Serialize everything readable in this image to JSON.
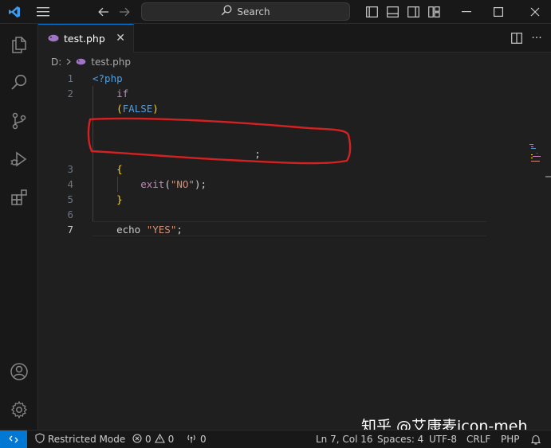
{
  "titlebar": {
    "search_placeholder": "Search"
  },
  "tab": {
    "filename": "test.php"
  },
  "breadcrumb": {
    "drive": "D:",
    "file": "test.php"
  },
  "editor": {
    "lines": [
      {
        "num": "1",
        "parts": [
          [
            "c-tag",
            "<?php"
          ]
        ]
      },
      {
        "num": "2",
        "parts": [
          [
            "c-plain",
            "    "
          ],
          [
            "c-kw",
            "if"
          ]
        ]
      },
      {
        "num": "",
        "parts": [
          [
            "c-plain",
            "    "
          ],
          [
            "c-paren",
            "("
          ],
          [
            "c-const",
            "FALSE"
          ],
          [
            "c-paren",
            ")"
          ]
        ]
      },
      {
        "num": "",
        "parts": []
      },
      {
        "num": "",
        "parts": []
      },
      {
        "num": "",
        "parts": [
          [
            "c-plain",
            "                           ;"
          ]
        ]
      },
      {
        "num": "3",
        "parts": [
          [
            "c-plain",
            "    "
          ],
          [
            "c-paren",
            "{"
          ]
        ]
      },
      {
        "num": "4",
        "parts": [
          [
            "c-plain",
            "        "
          ],
          [
            "c-fn",
            "exit"
          ],
          [
            "c-plain",
            "("
          ],
          [
            "c-str",
            "\"NO\""
          ],
          [
            "c-plain",
            ");"
          ]
        ]
      },
      {
        "num": "5",
        "parts": [
          [
            "c-plain",
            "    "
          ],
          [
            "c-paren",
            "}"
          ]
        ]
      },
      {
        "num": "6",
        "parts": []
      },
      {
        "num": "7",
        "parts": [
          [
            "c-plain",
            "    echo "
          ],
          [
            "c-str",
            "\"YES\""
          ],
          [
            "c-plain",
            ";"
          ]
        ]
      }
    ],
    "active_line": "7"
  },
  "watermark": "知乎 @艾康麦icon-meh",
  "statusbar": {
    "restricted_mode": "Restricted Mode",
    "errors": "0",
    "warnings": "0",
    "ports": "0",
    "position": "Ln 7, Col 16",
    "spaces": "Spaces: 4",
    "encoding": "UTF-8",
    "eol": "CRLF",
    "language": "PHP"
  },
  "colors": {
    "accent": "#0078d4",
    "annotation": "#d42222"
  }
}
